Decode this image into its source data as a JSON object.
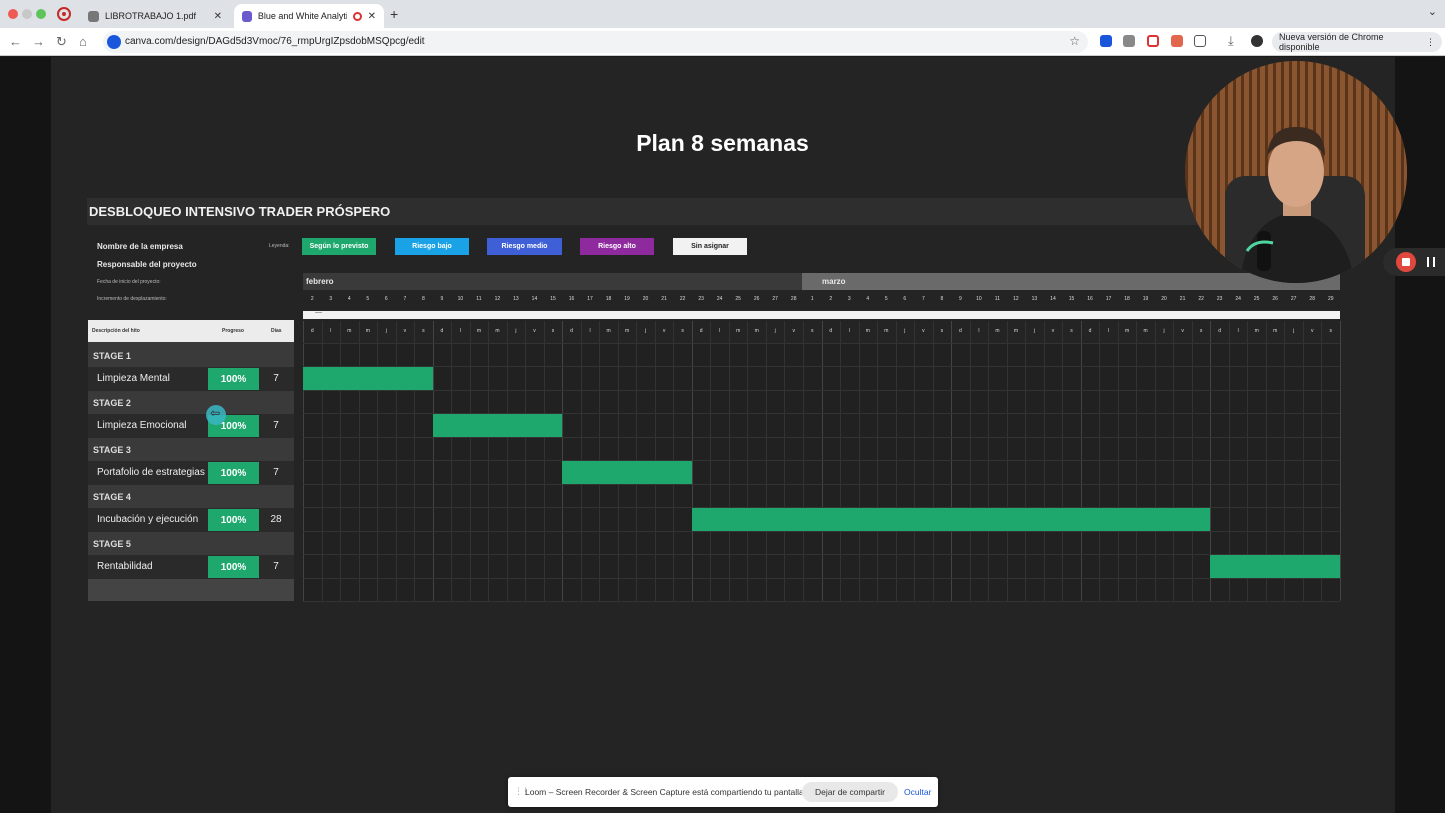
{
  "browser": {
    "tabs": [
      {
        "label": "LIBROTRABAJO 1.pdf"
      },
      {
        "label": "Blue and White Analytic D"
      }
    ],
    "url": "canva.com/design/DAGd5d3Vmoc/76_rmpUrgIZpsdobMSQpcg/edit",
    "update_label": "Nueva versión de Chrome disponible"
  },
  "slide": {
    "title": "Plan 8 semanas",
    "project_title": "DESBLOQUEO INTENSIVO TRADER PRÓSPERO",
    "company_label": "Nombre de la empresa",
    "manager_label": "Responsable del proyecto",
    "start_date_label": "Fecha de inicio del proyecto:",
    "scroll_increment_label": "Incremento de desplazamiento:",
    "legend_label": "Leyenda:",
    "legend": [
      {
        "label": "Según lo previsto",
        "color": "#1fa86e",
        "text_color": "#ffffff"
      },
      {
        "label": "Riesgo bajo",
        "color": "#1aa2e6",
        "text_color": "#ffffff"
      },
      {
        "label": "Riesgo medio",
        "color": "#3f5fd6",
        "text_color": "#ffffff"
      },
      {
        "label": "Riesgo alto",
        "color": "#8e2a9e",
        "text_color": "#ffffff"
      },
      {
        "label": "Sin asignar",
        "color": "#f2f2f2",
        "text_color": "#222222"
      }
    ],
    "months": [
      {
        "label": "febrero"
      },
      {
        "label": "marzo"
      }
    ],
    "days": [
      "2",
      "3",
      "4",
      "5",
      "6",
      "7",
      "8",
      "9",
      "10",
      "11",
      "12",
      "13",
      "14",
      "15",
      "16",
      "17",
      "18",
      "19",
      "20",
      "21",
      "22",
      "23",
      "24",
      "25",
      "26",
      "27",
      "28",
      "1",
      "2",
      "3",
      "4",
      "5",
      "6",
      "7",
      "8",
      "9",
      "10",
      "11",
      "12",
      "13",
      "14",
      "15",
      "16",
      "17",
      "18",
      "19",
      "20",
      "21",
      "22",
      "23",
      "24",
      "25",
      "26",
      "27",
      "28",
      "29"
    ],
    "day_letters": [
      "d",
      "l",
      "m",
      "m",
      "j",
      "v",
      "s",
      "d",
      "l",
      "m",
      "m",
      "j",
      "v",
      "s",
      "d",
      "l",
      "m",
      "m",
      "j",
      "v",
      "s",
      "d",
      "l",
      "m",
      "m",
      "j",
      "v",
      "s",
      "d",
      "l",
      "m",
      "m",
      "j",
      "v",
      "s",
      "d",
      "l",
      "m",
      "m",
      "j",
      "v",
      "s",
      "d",
      "l",
      "m",
      "m",
      "j",
      "v",
      "s",
      "d",
      "l",
      "m",
      "m",
      "j",
      "v",
      "s"
    ],
    "strip_mark": "—",
    "table_headers": {
      "description": "Descripción del hito",
      "progress": "Progreso",
      "days": "Días"
    },
    "stages": [
      {
        "stage": "STAGE 1",
        "task": "Limpieza Mental",
        "progress": "100%",
        "days": "7",
        "start_index": 0,
        "duration": 7
      },
      {
        "stage": "STAGE 2",
        "task": "Limpieza Emocional",
        "progress": "100%",
        "days": "7",
        "start_index": 7,
        "duration": 7
      },
      {
        "stage": "STAGE 3",
        "task": "Portafolio de estrategias",
        "progress": "100%",
        "days": "7",
        "start_index": 14,
        "duration": 7
      },
      {
        "stage": "STAGE 4",
        "task": "Incubación y ejecución",
        "progress": "100%",
        "days": "28",
        "start_index": 21,
        "duration": 28
      },
      {
        "stage": "STAGE 5",
        "task": "Rentabilidad",
        "progress": "100%",
        "days": "7",
        "start_index": 49,
        "duration": 7
      }
    ]
  },
  "loom": {
    "message": "Loom – Screen Recorder & Screen Capture está compartiendo tu pantalla.",
    "stop_label": "Dejar de compartir",
    "hide_label": "Ocultar"
  }
}
